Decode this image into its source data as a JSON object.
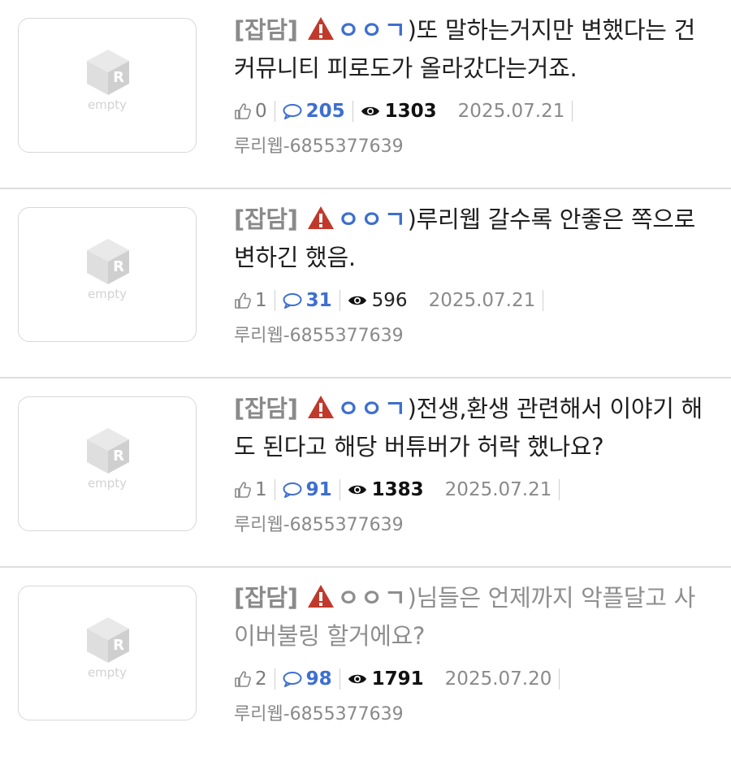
{
  "posts": [
    {
      "thumb_label": "empty",
      "category": "[잡담]",
      "subject": "ㅇㅇㄱ",
      "title_rest": ")또 말하는거지만 변했다는 건 커뮤니티 피로도가 올라갔다는거죠.",
      "likes": "0",
      "comments": "205",
      "views": "1303",
      "date": "2025.07.21",
      "author": "루리웹-6855377639",
      "read": false
    },
    {
      "thumb_label": "empty",
      "category": "[잡담]",
      "subject": "ㅇㅇㄱ",
      "title_rest": ")루리웹 갈수록 안좋은 쪽으로 변하긴 했음.",
      "likes": "1",
      "comments": "31",
      "views": "596",
      "date": "2025.07.21",
      "author": "루리웹-6855377639",
      "read": false
    },
    {
      "thumb_label": "empty",
      "category": "[잡담]",
      "subject": "ㅇㅇㄱ",
      "title_rest": ")전생,환생 관련해서 이야기 해도 된다고 해당 버튜버가 허락 했나요?",
      "likes": "1",
      "comments": "91",
      "views": "1383",
      "date": "2025.07.21",
      "author": "루리웹-6855377639",
      "read": false
    },
    {
      "thumb_label": "empty",
      "category": "[잡담]",
      "subject": "ㅇㅇㄱ",
      "title_rest": ")님들은 언제까지 악플달고 사이버불링 할거에요?",
      "likes": "2",
      "comments": "98",
      "views": "1791",
      "date": "2025.07.20",
      "author": "루리웹-6855377639",
      "read": true
    }
  ],
  "icons": {
    "warning": "warning-triangle-icon",
    "like": "thumbs-up-icon",
    "comment": "comment-bubble-icon",
    "views": "eye-icon",
    "placeholder": "empty-cube-logo-icon"
  },
  "colors": {
    "accent_blue": "#3d6fd0",
    "warning_red": "#c0392b",
    "muted_gray": "#8a8a8a"
  }
}
